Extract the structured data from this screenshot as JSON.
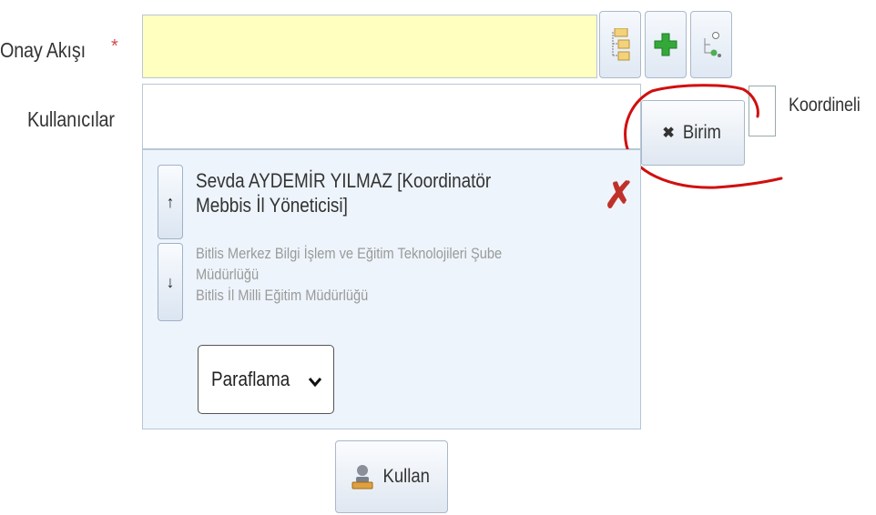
{
  "form": {
    "onay_akisi_label": "Onay Akışı",
    "required_mark": "*",
    "kullanicilar_label": "Kullanıcılar",
    "koordineli_label": "Koordineli"
  },
  "birim_button": {
    "icon": "✖",
    "label": "Birim"
  },
  "user_entry": {
    "name_line1": "Sevda AYDEMİR YILMAZ [Koordinatör",
    "name_line2": "Mebbis İl Yöneticisi]",
    "unit_line1": "Bitlis Merkez Bilgi İşlem ve Eğitim Teknolojileri Şube",
    "unit_line2": "Müdürlüğü",
    "unit_line3": "Bitlis İl Milli Eğitim Müdürlüğü",
    "up_arrow": "↑",
    "down_arrow": "↓",
    "delete_mark": "✗",
    "action_select": {
      "selected": "Paraflama",
      "chevron": "⌄"
    }
  },
  "kullan_button": {
    "label": "Kullan"
  },
  "colors": {
    "required": "#d24a4a",
    "field_highlight": "#ffffbf",
    "panel_bg": "#edf4fb",
    "annotation_circle": "#d10f0f",
    "delete_x": "#c0302b",
    "plus_green": "#34a93a"
  },
  "icons": [
    "tree-list-icon",
    "add-icon",
    "workflow-icon",
    "remove-icon",
    "arrow-up-icon",
    "arrow-down-icon",
    "delete-icon",
    "chevron-down-icon",
    "user-stamp-icon"
  ]
}
